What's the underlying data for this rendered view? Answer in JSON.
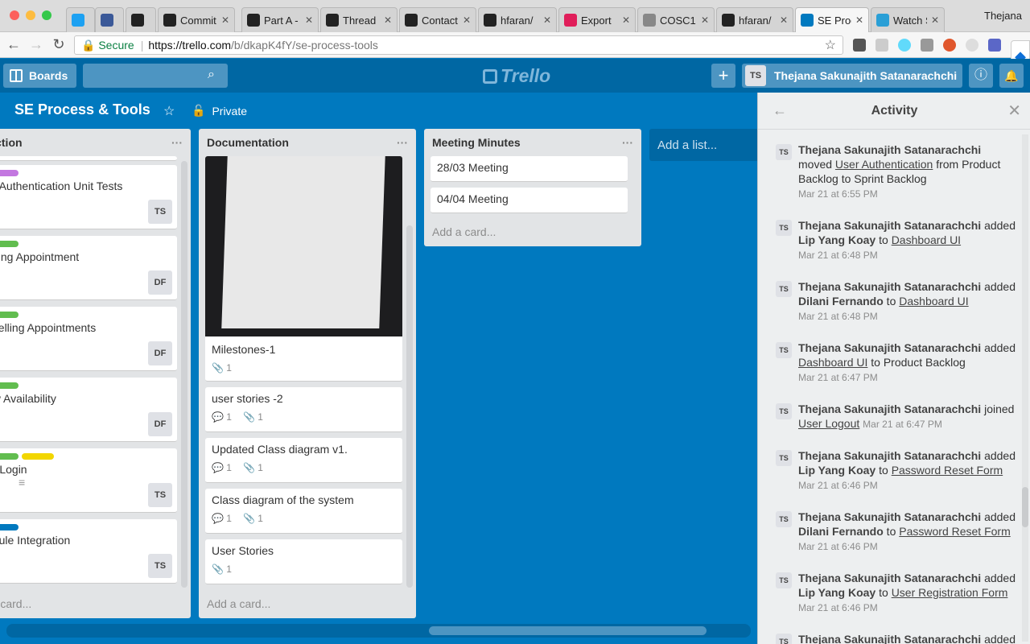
{
  "browser": {
    "tabs": [
      {
        "title": "",
        "icon": "twitter-icon",
        "color": "#1da1f2"
      },
      {
        "title": "",
        "icon": "facebook-icon",
        "color": "#3b5998"
      },
      {
        "title": "",
        "icon": "github-icon",
        "color": "#222222"
      },
      {
        "title": "Commit",
        "icon": "github-icon",
        "color": "#222222"
      },
      {
        "title": "Part A -",
        "icon": "blackboard-icon",
        "color": "#222222"
      },
      {
        "title": "Thread",
        "icon": "blackboard-icon",
        "color": "#222222"
      },
      {
        "title": "Contact",
        "icon": "blackboard-icon",
        "color": "#222222"
      },
      {
        "title": "hfaran/",
        "icon": "github-icon",
        "color": "#222222"
      },
      {
        "title": "Export",
        "icon": "slack-icon",
        "color": "#e01e5a"
      },
      {
        "title": "COSC1",
        "icon": "document-icon",
        "color": "#888888"
      },
      {
        "title": "hfaran/",
        "icon": "github-icon",
        "color": "#222222"
      },
      {
        "title": "SE Proc",
        "icon": "trello-icon",
        "color": "#0079bf"
      },
      {
        "title": "Watch S",
        "icon": "cube-icon",
        "color": "#2a9fd6"
      }
    ],
    "profile": "Thejana",
    "secure_label": "Secure",
    "url_host": "https://trello.com",
    "url_path": "/b/dkapK4fY/se-process-tools"
  },
  "header": {
    "boards_label": "Boards",
    "logo_text": "Trello",
    "member_initials": "TS",
    "member_name": "Thejana Sakunajith Satanarachchi"
  },
  "board": {
    "title": "SE Process & Tools",
    "privacy": "Private"
  },
  "lists": {
    "production": {
      "title": "duction",
      "cards": [
        {
          "title": "er Authentication Unit Tests",
          "member": "TS",
          "labels": [
            "#c377e0"
          ]
        },
        {
          "title": "oking Appointment",
          "member": "DF",
          "labels": [
            "#61bd4f"
          ]
        },
        {
          "title": "ncelling Appointments",
          "member": "DF",
          "labels": [
            "#61bd4f"
          ]
        },
        {
          "title": "ew Availability",
          "member": "DF",
          "labels": [
            "#61bd4f"
          ]
        },
        {
          "title": "er Login",
          "member": "TS",
          "labels": [
            "#61bd4f",
            "#f2d600"
          ]
        },
        {
          "title": "odule Integration",
          "member": "TS",
          "labels": [
            "#0079bf"
          ]
        }
      ],
      "add_card": "d a card..."
    },
    "documentation": {
      "title": "Documentation",
      "cards": [
        {
          "title": "Milestones-1",
          "comments": "",
          "attachments": "1"
        },
        {
          "title": "user stories -2",
          "comments": "1",
          "attachments": "1"
        },
        {
          "title": "Updated Class diagram v1.",
          "comments": "1",
          "attachments": "1"
        },
        {
          "title": "Class diagram of the system",
          "comments": "1",
          "attachments": "1"
        },
        {
          "title": "User Stories",
          "comments": "",
          "attachments": "1"
        }
      ],
      "add_card": "Add a card..."
    },
    "meeting": {
      "title": "Meeting Minutes",
      "cards": [
        {
          "title": "28/03 Meeting"
        },
        {
          "title": "04/04 Meeting"
        }
      ],
      "add_card": "Add a card..."
    },
    "add_list": "Add a list..."
  },
  "activity": {
    "title": "Activity",
    "items": [
      {
        "initials": "TS",
        "actor": "Thejana Sakunajith Satanarachchi",
        "verb": " moved ",
        "member": "",
        "mid": "",
        "card": "User Authentication",
        "tail": " from Product Backlog to Sprint Backlog",
        "time": "Mar 21 at 6:55 PM"
      },
      {
        "initials": "TS",
        "actor": "Thejana Sakunajith Satanarachchi",
        "verb": " added ",
        "member": "Lip Yang Koay",
        "mid": " to ",
        "card": "Dashboard UI",
        "tail": "",
        "time": "Mar 21 at 6:48 PM"
      },
      {
        "initials": "TS",
        "actor": "Thejana Sakunajith Satanarachchi",
        "verb": " added ",
        "member": "Dilani Fernando",
        "mid": " to ",
        "card": "Dashboard UI",
        "tail": "",
        "time": "Mar 21 at 6:48 PM"
      },
      {
        "initials": "TS",
        "actor": "Thejana Sakunajith Satanarachchi",
        "verb": " added ",
        "member": "",
        "mid": "",
        "card": "Dashboard UI",
        "tail": " to Product Backlog",
        "time": "Mar 21 at 6:47 PM"
      },
      {
        "initials": "TS",
        "actor": "Thejana Sakunajith Satanarachchi",
        "verb": " joined ",
        "member": "",
        "mid": "",
        "card": "User Logout",
        "tail": " ",
        "time": "Mar 21 at 6:47 PM"
      },
      {
        "initials": "TS",
        "actor": "Thejana Sakunajith Satanarachchi",
        "verb": " added ",
        "member": "Lip Yang Koay",
        "mid": " to ",
        "card": "Password Reset Form",
        "tail": "",
        "time": "Mar 21 at 6:46 PM"
      },
      {
        "initials": "TS",
        "actor": "Thejana Sakunajith Satanarachchi",
        "verb": " added ",
        "member": "Dilani Fernando",
        "mid": " to ",
        "card": "Password Reset Form",
        "tail": "",
        "time": "Mar 21 at 6:46 PM"
      },
      {
        "initials": "TS",
        "actor": "Thejana Sakunajith Satanarachchi",
        "verb": " added ",
        "member": "Lip Yang Koay",
        "mid": " to ",
        "card": "User Registration Form",
        "tail": "",
        "time": "Mar 21 at 6:46 PM"
      },
      {
        "initials": "TS",
        "actor": "Thejana Sakunajith Satanarachchi",
        "verb": " added ",
        "member": "",
        "mid": "",
        "card": "",
        "tail": "",
        "time": ""
      }
    ]
  }
}
